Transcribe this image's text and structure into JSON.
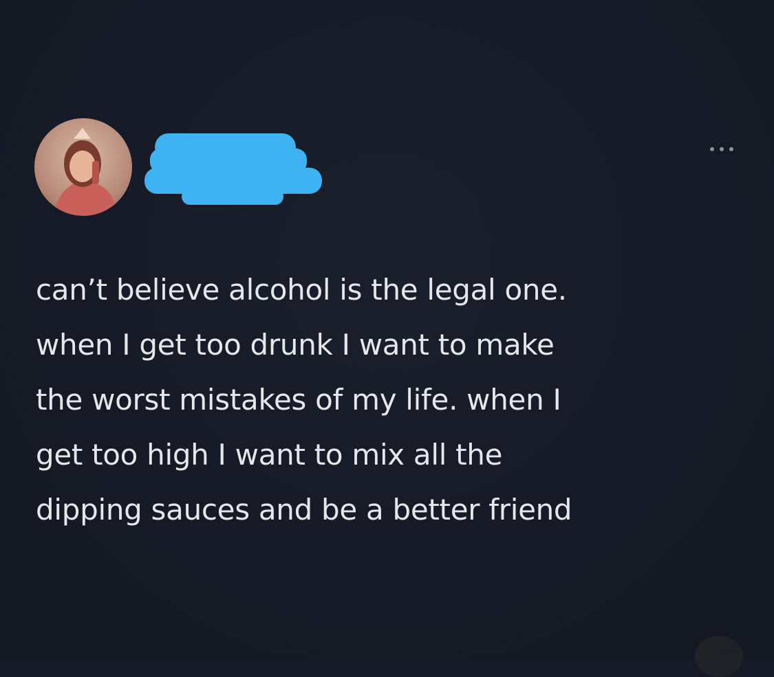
{
  "post": {
    "text_lines": [
      "can’t believe alcohol is the legal one.",
      "when I get too drunk I want to make",
      "the worst mistakes of my life. when I",
      "get too high I want to mix all the",
      "dipping sauces and be a better friend"
    ]
  },
  "author": {
    "avatar_icon": "avatar-photo",
    "name_redacted": true
  },
  "menu": {
    "icon": "more-horizontal-icon"
  },
  "colors": {
    "background": "#161a26",
    "text": "#e6e7ea",
    "redaction": "#3fb2f2",
    "menu_dots": "#8c919b"
  }
}
